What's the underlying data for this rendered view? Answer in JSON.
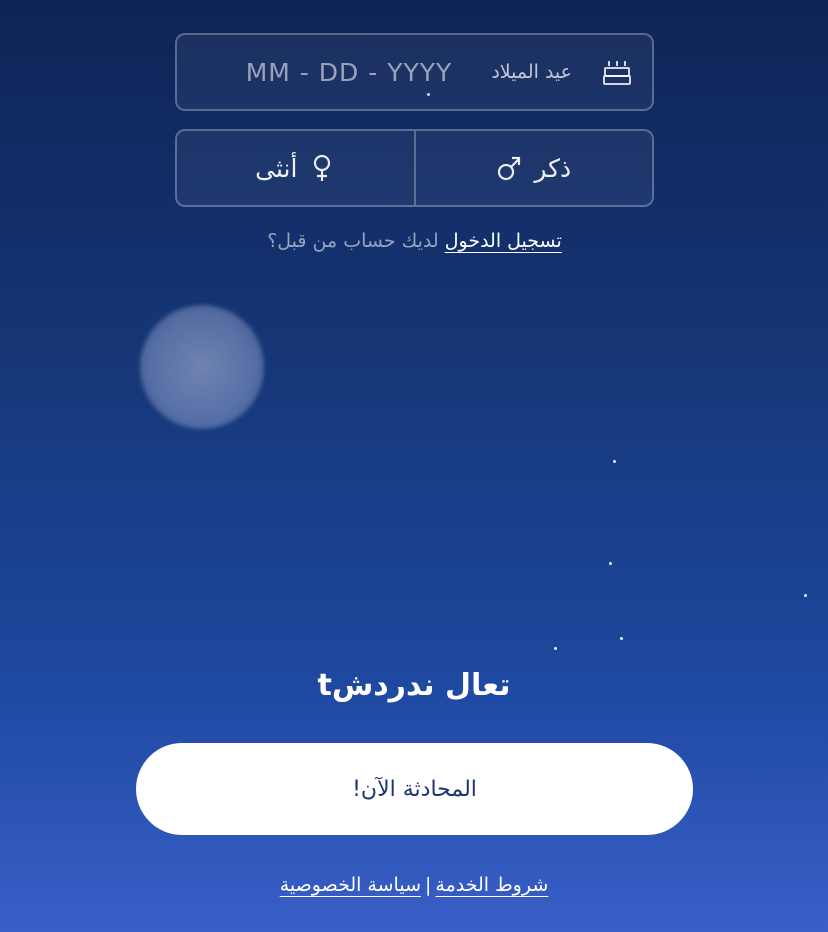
{
  "birthday": {
    "label": "عيد الميلاد",
    "placeholder": "MM - DD - YYYY",
    "icon": "birthday-cake-icon"
  },
  "gender": {
    "female_label": "أنثى",
    "male_label": "ذكر",
    "female_icon": "female-symbol-icon",
    "male_icon": "male-symbol-icon"
  },
  "login": {
    "link_text": "تسجيل الدخول",
    "prompt_text": "لديك حساب من قبل؟"
  },
  "slogan": "تعال ندردشt",
  "cta_label": "المحادثة الآن!",
  "footer": {
    "terms_label": "شروط الخدمة",
    "separator": "|",
    "privacy_label": "سياسة الخصوصية"
  },
  "colors": {
    "background_top": "#0e2456",
    "background_bottom": "#3a5fc9",
    "button_bg": "#ffffff",
    "button_text": "#1c3470"
  }
}
